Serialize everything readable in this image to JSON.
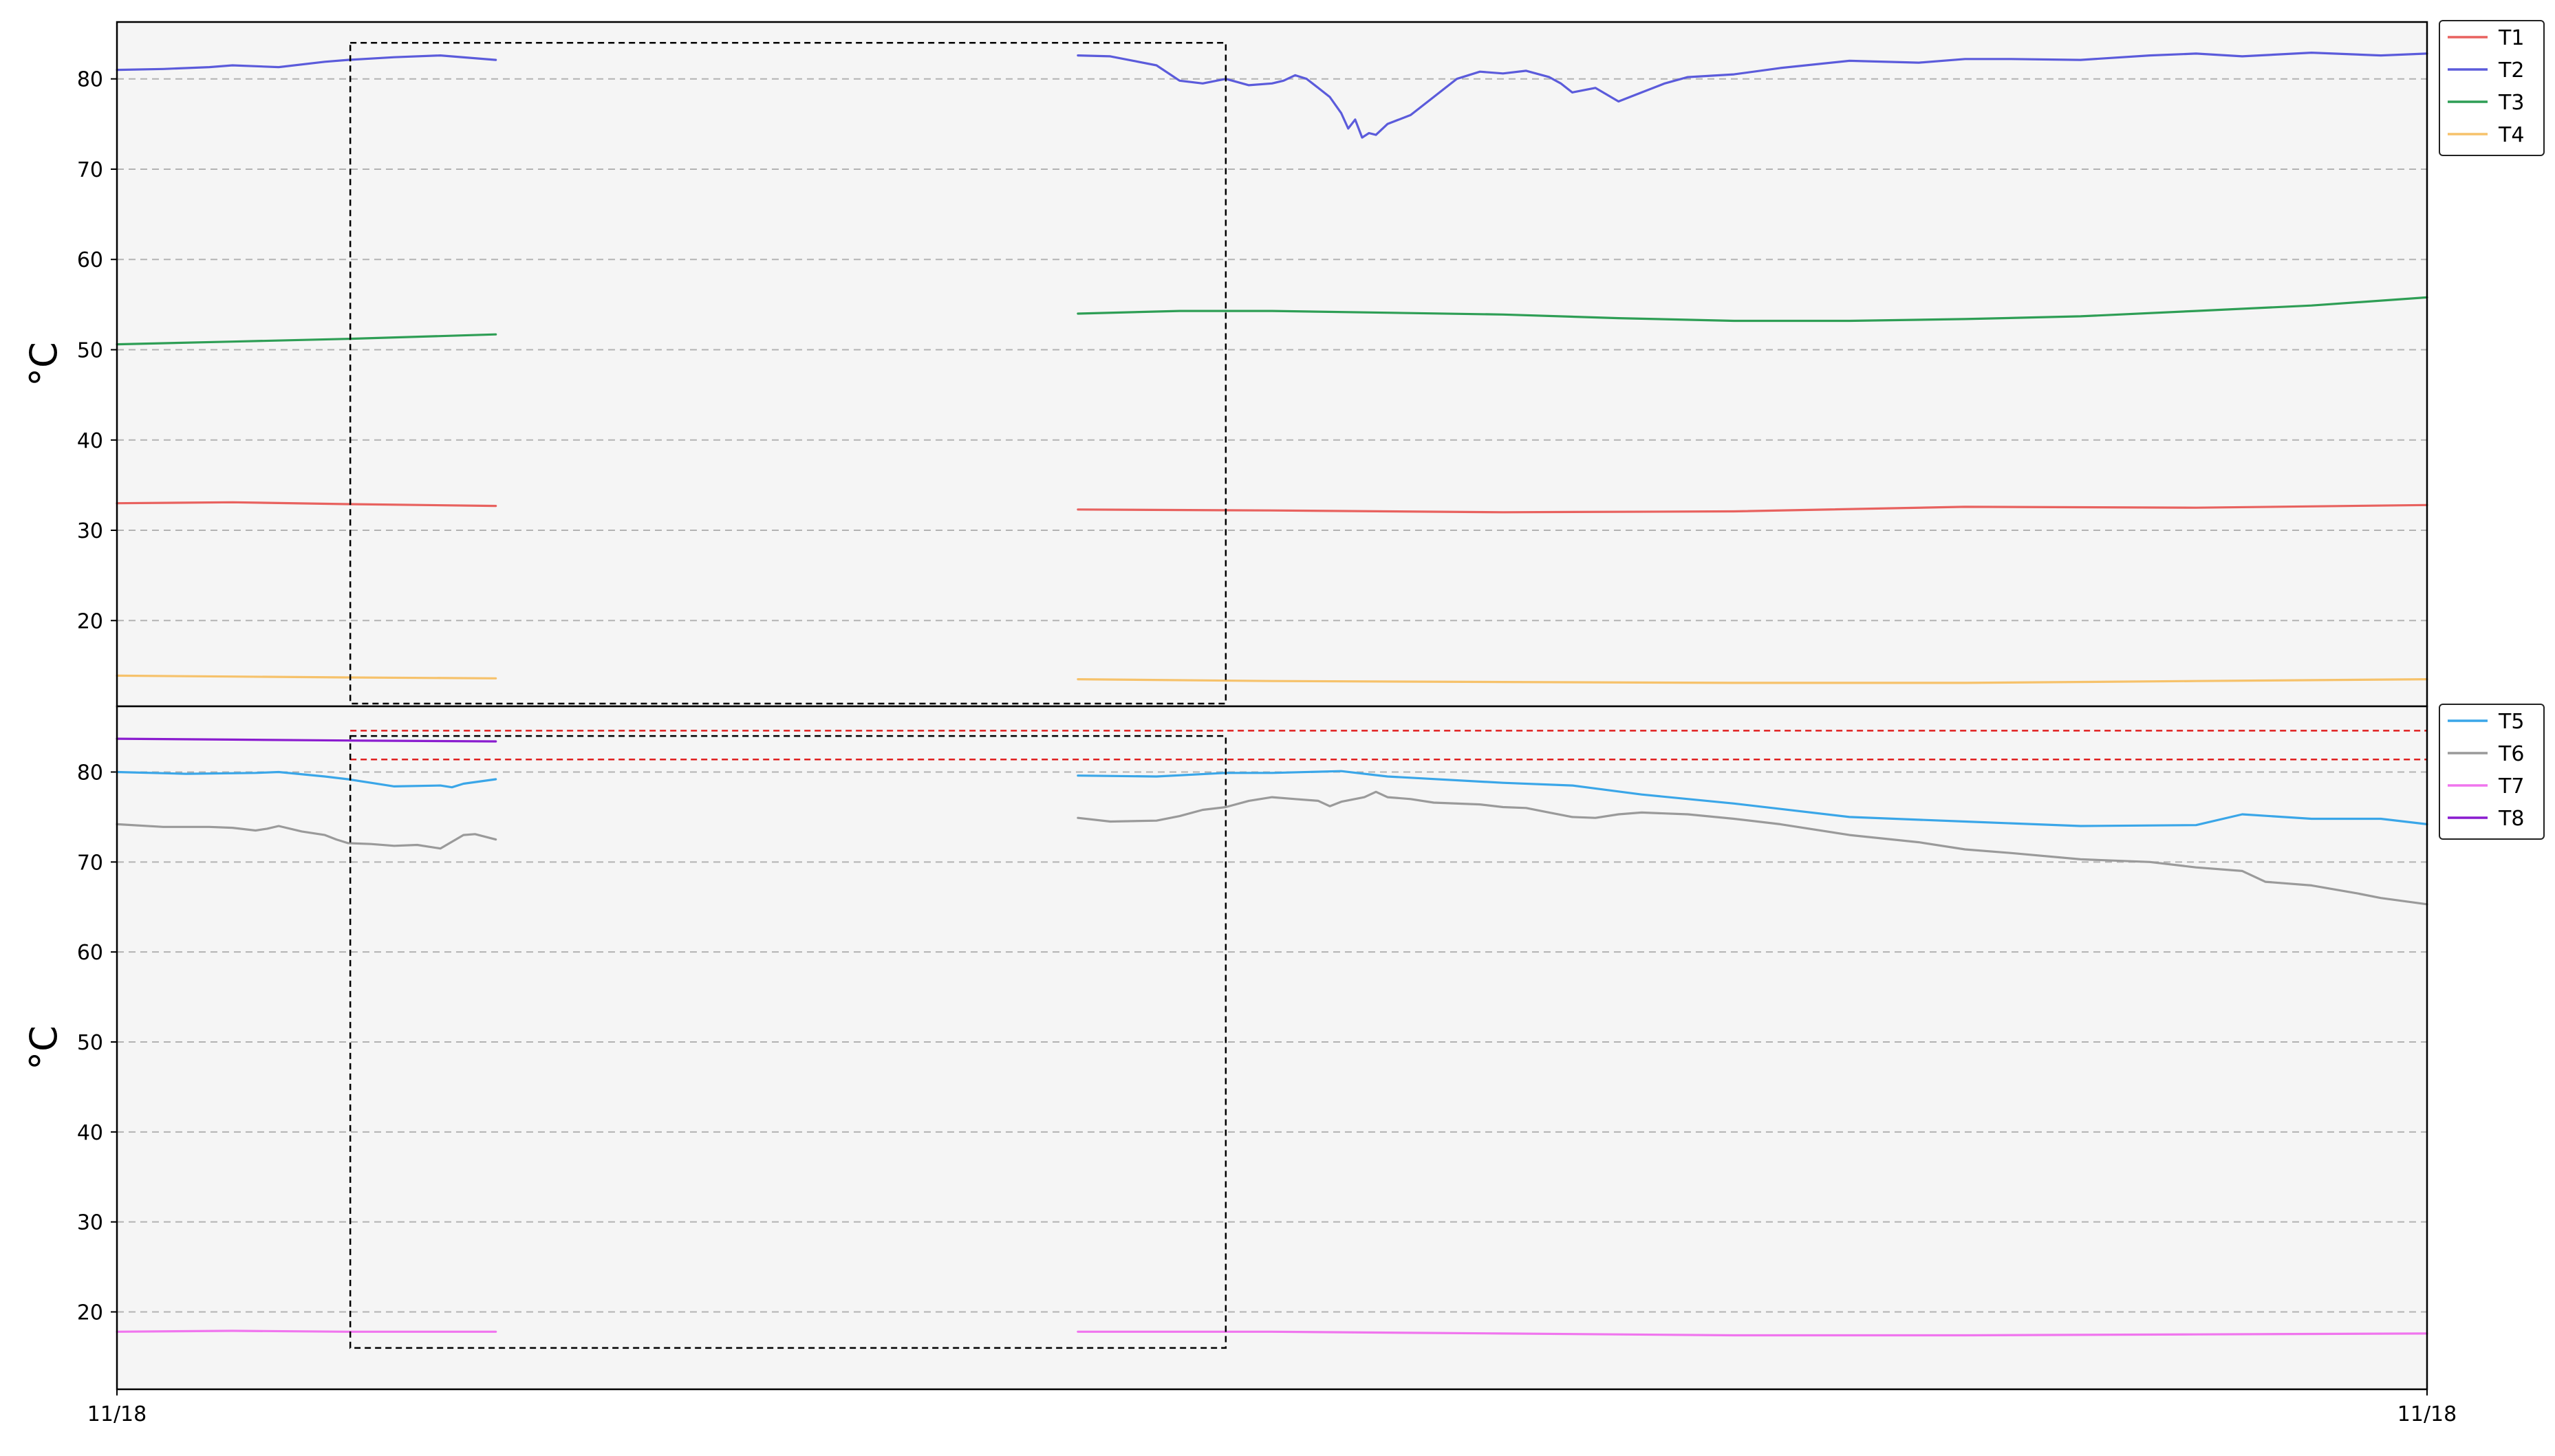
{
  "colors": {
    "T1": "#e8625f",
    "T2": "#5b5bdb",
    "T3": "#2e9e55",
    "T4": "#f6c26b",
    "T5": "#3aa6e8",
    "T6": "#9a9a9a",
    "T7": "#f075ee",
    "T8": "#8a1ccf",
    "plot_bg": "#f5f5f5",
    "grid": "#b3b3b3",
    "box": "#000000",
    "threshold": "#e02020"
  },
  "chart_data": [
    {
      "type": "line",
      "ylabel": "°C",
      "xlabel": "",
      "x_range": [
        0,
        100
      ],
      "ylim": [
        10.5,
        86.3
      ],
      "y_ticks": [
        20,
        30,
        40,
        50,
        60,
        70,
        80
      ],
      "x_tick_labels": [],
      "grid": true,
      "legend": "outside-top-right",
      "box": {
        "x": [
          10.1,
          48.0
        ],
        "y": [
          10.8,
          84.0
        ]
      },
      "series": [
        {
          "name": "T1",
          "segments": [
            {
              "x": [
                0,
                5,
                10,
                16.4
              ],
              "y": [
                33.0,
                33.1,
                32.9,
                32.7
              ]
            },
            {
              "x": [
                41.6,
                50,
                60,
                70,
                80,
                90,
                100
              ],
              "y": [
                32.3,
                32.2,
                32.0,
                32.1,
                32.6,
                32.5,
                32.8
              ]
            }
          ]
        },
        {
          "name": "T2",
          "segments": [
            {
              "x": [
                0,
                2,
                4,
                5,
                7,
                9,
                10,
                12,
                14,
                16.4
              ],
              "y": [
                81.0,
                81.1,
                81.3,
                81.5,
                81.3,
                81.9,
                82.1,
                82.4,
                82.6,
                82.1
              ]
            },
            {
              "x": [
                41.6,
                43,
                44,
                45,
                46,
                47,
                48,
                49,
                50,
                50.5,
                51,
                51.5,
                52,
                52.5,
                53,
                53.3,
                53.6,
                53.9,
                54.2,
                54.5,
                55,
                56,
                57,
                58,
                59,
                60,
                61,
                62,
                62.5,
                63,
                64,
                65,
                66,
                67,
                68,
                70,
                72,
                75,
                78,
                80,
                82,
                85,
                88,
                90,
                92,
                95,
                98,
                100
              ],
              "y": [
                82.6,
                82.5,
                82.0,
                81.5,
                79.8,
                79.5,
                80.0,
                79.3,
                79.5,
                79.8,
                80.4,
                80.0,
                79.0,
                78.0,
                76.2,
                74.5,
                75.5,
                73.5,
                74.0,
                73.8,
                75.0,
                76.0,
                78.0,
                80.0,
                80.8,
                80.6,
                80.9,
                80.2,
                79.5,
                78.5,
                79.0,
                77.5,
                78.5,
                79.5,
                80.2,
                80.5,
                81.2,
                82.0,
                81.8,
                82.2,
                82.2,
                82.1,
                82.6,
                82.8,
                82.5,
                82.9,
                82.6,
                82.8
              ]
            }
          ]
        },
        {
          "name": "T3",
          "segments": [
            {
              "x": [
                0,
                5,
                10,
                16.4
              ],
              "y": [
                50.6,
                50.9,
                51.2,
                51.7
              ]
            },
            {
              "x": [
                41.6,
                46,
                50,
                55,
                60,
                65,
                70,
                75,
                80,
                85,
                90,
                95,
                100
              ],
              "y": [
                54.0,
                54.3,
                54.3,
                54.1,
                53.9,
                53.5,
                53.2,
                53.2,
                53.4,
                53.7,
                54.3,
                54.9,
                55.8
              ]
            }
          ]
        },
        {
          "name": "T4",
          "segments": [
            {
              "x": [
                0,
                5,
                10,
                16.4
              ],
              "y": [
                13.9,
                13.8,
                13.7,
                13.6
              ]
            },
            {
              "x": [
                41.6,
                50,
                60,
                70,
                80,
                90,
                100
              ],
              "y": [
                13.5,
                13.3,
                13.2,
                13.1,
                13.1,
                13.3,
                13.5
              ]
            }
          ]
        }
      ]
    },
    {
      "type": "line",
      "ylabel": "°C",
      "xlabel": "",
      "x_range": [
        0,
        100
      ],
      "ylim": [
        11.4,
        87.3
      ],
      "y_ticks": [
        20,
        30,
        40,
        50,
        60,
        70,
        80
      ],
      "x_tick_labels": [
        "11/18",
        "11/18"
      ],
      "grid": true,
      "legend": "outside-top-right",
      "box": {
        "x": [
          10.1,
          48.0
        ],
        "y": [
          16.0,
          84.0
        ]
      },
      "threshold_lines": [
        {
          "y": 84.6,
          "x": [
            10.1,
            100
          ]
        },
        {
          "y": 81.4,
          "x": [
            10.1,
            100
          ]
        }
      ],
      "series": [
        {
          "name": "T5",
          "segments": [
            {
              "x": [
                0,
                3,
                6,
                7,
                9,
                10,
                11,
                12,
                14,
                14.5,
                15,
                16.4
              ],
              "y": [
                80.0,
                79.8,
                79.9,
                80.0,
                79.5,
                79.2,
                78.8,
                78.4,
                78.5,
                78.3,
                78.7,
                79.2
              ]
            },
            {
              "x": [
                41.6,
                45,
                48,
                50,
                53,
                55,
                60,
                63,
                66,
                70,
                75,
                80,
                85,
                90,
                92,
                95,
                98,
                100
              ],
              "y": [
                79.6,
                79.5,
                79.9,
                79.9,
                80.1,
                79.5,
                78.8,
                78.5,
                77.5,
                76.5,
                75.0,
                74.5,
                74.0,
                74.1,
                75.3,
                74.8,
                74.8,
                74.2
              ]
            }
          ]
        },
        {
          "name": "T6",
          "segments": [
            {
              "x": [
                0,
                2,
                4,
                5,
                6,
                6.5,
                7,
                8,
                9,
                9.5,
                10,
                11,
                12,
                13,
                14,
                15,
                15.5,
                16.4
              ],
              "y": [
                74.2,
                73.9,
                73.9,
                73.8,
                73.5,
                73.7,
                74.0,
                73.4,
                73.0,
                72.5,
                72.1,
                72.0,
                71.8,
                71.9,
                71.5,
                73.0,
                73.1,
                72.5
              ]
            },
            {
              "x": [
                41.6,
                43,
                45,
                46,
                47,
                48,
                49,
                50,
                51,
                52,
                52.5,
                53,
                54,
                54.5,
                55,
                56,
                57,
                59,
                60,
                61,
                62,
                63,
                64,
                65,
                66,
                68,
                70,
                72,
                75,
                78,
                80,
                82,
                85,
                88,
                90,
                92,
                93,
                95,
                97,
                98,
                100
              ],
              "y": [
                74.9,
                74.5,
                74.6,
                75.1,
                75.8,
                76.1,
                76.8,
                77.2,
                77.0,
                76.8,
                76.2,
                76.7,
                77.2,
                77.8,
                77.2,
                77.0,
                76.6,
                76.4,
                76.1,
                76.0,
                75.5,
                75.0,
                74.9,
                75.3,
                75.5,
                75.3,
                74.8,
                74.2,
                73.0,
                72.2,
                71.4,
                71.0,
                70.3,
                70.0,
                69.4,
                69.0,
                67.8,
                67.4,
                66.5,
                66.0,
                65.3
              ]
            }
          ]
        },
        {
          "name": "T7",
          "segments": [
            {
              "x": [
                0,
                5,
                10,
                16.4
              ],
              "y": [
                17.8,
                17.9,
                17.8,
                17.8
              ]
            },
            {
              "x": [
                41.6,
                50,
                60,
                70,
                80,
                90,
                100
              ],
              "y": [
                17.8,
                17.8,
                17.6,
                17.4,
                17.4,
                17.5,
                17.6
              ]
            }
          ]
        },
        {
          "name": "T8",
          "segments": [
            {
              "x": [
                0,
                5,
                10,
                16.4
              ],
              "y": [
                83.7,
                83.6,
                83.5,
                83.4
              ]
            }
          ]
        }
      ]
    }
  ]
}
